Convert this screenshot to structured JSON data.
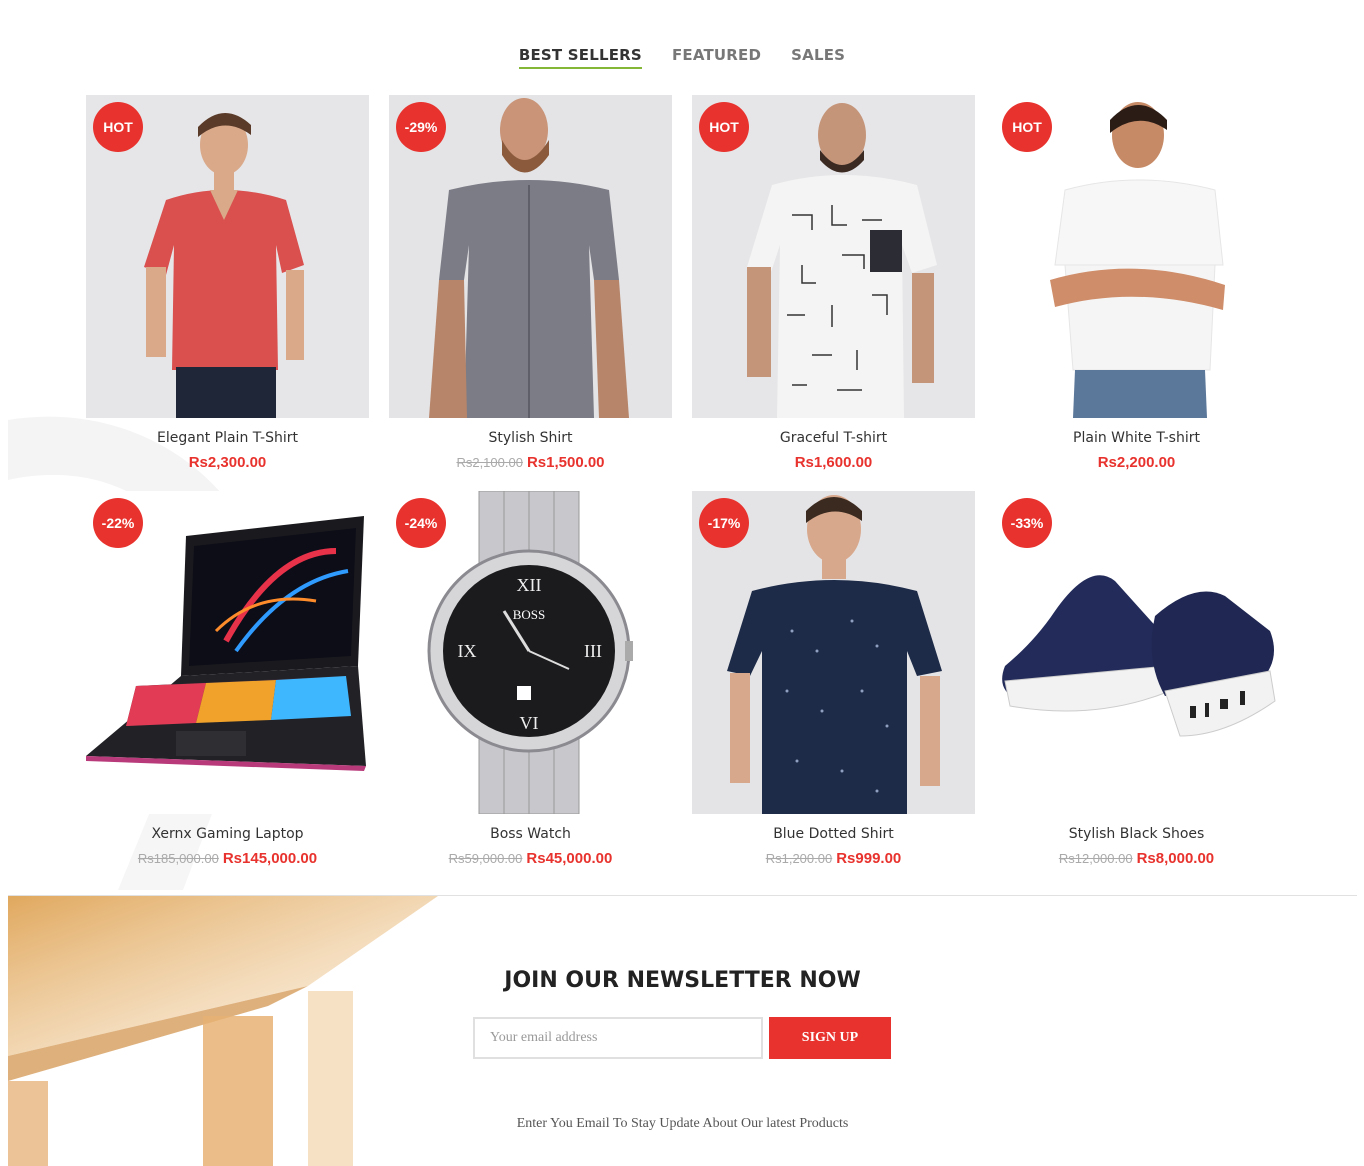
{
  "tabs": [
    {
      "label": "BEST SELLERS",
      "active": true
    },
    {
      "label": "FEATURED",
      "active": false
    },
    {
      "label": "SALES",
      "active": false
    }
  ],
  "products": [
    {
      "name": "Elegant Plain T-Shirt",
      "badge": "HOT",
      "old_price": "",
      "price": "Rs2,300.00",
      "image": "man in red v-neck t-shirt"
    },
    {
      "name": "Stylish Shirt",
      "badge": "-29%",
      "old_price": "Rs2,100.00",
      "price": "Rs1,500.00",
      "image": "man in grey checked shirt"
    },
    {
      "name": "Graceful T-shirt",
      "badge": "HOT",
      "old_price": "",
      "price": "Rs1,600.00",
      "image": "man in white patterned t-shirt"
    },
    {
      "name": "Plain White T-shirt",
      "badge": "HOT",
      "old_price": "",
      "price": "Rs2,200.00",
      "image": "man in plain white t-shirt"
    },
    {
      "name": "Xernx Gaming Laptop",
      "badge": "-22%",
      "old_price": "Rs185,000.00",
      "price": "Rs145,000.00",
      "image": "gaming laptop with rgb keyboard"
    },
    {
      "name": "Boss Watch",
      "badge": "-24%",
      "old_price": "Rs59,000.00",
      "price": "Rs45,000.00",
      "image": "silver boss wrist watch"
    },
    {
      "name": "Blue Dotted Shirt",
      "badge": "-17%",
      "old_price": "Rs1,200.00",
      "price": "Rs999.00",
      "image": "man in navy dotted shirt"
    },
    {
      "name": "Stylish Black Shoes",
      "badge": "-33%",
      "old_price": "Rs12,000.00",
      "price": "Rs8,000.00",
      "image": "navy knit sneakers"
    }
  ],
  "watch_brand": "BOSS",
  "newsletter": {
    "title": "JOIN OUR NEWSLETTER NOW",
    "placeholder": "Your email address",
    "button": "SIGN UP",
    "note": "Enter You Email To Stay Update About Our latest Products"
  },
  "colors": {
    "accent": "#e8322d",
    "tab_underline": "#83b735"
  }
}
